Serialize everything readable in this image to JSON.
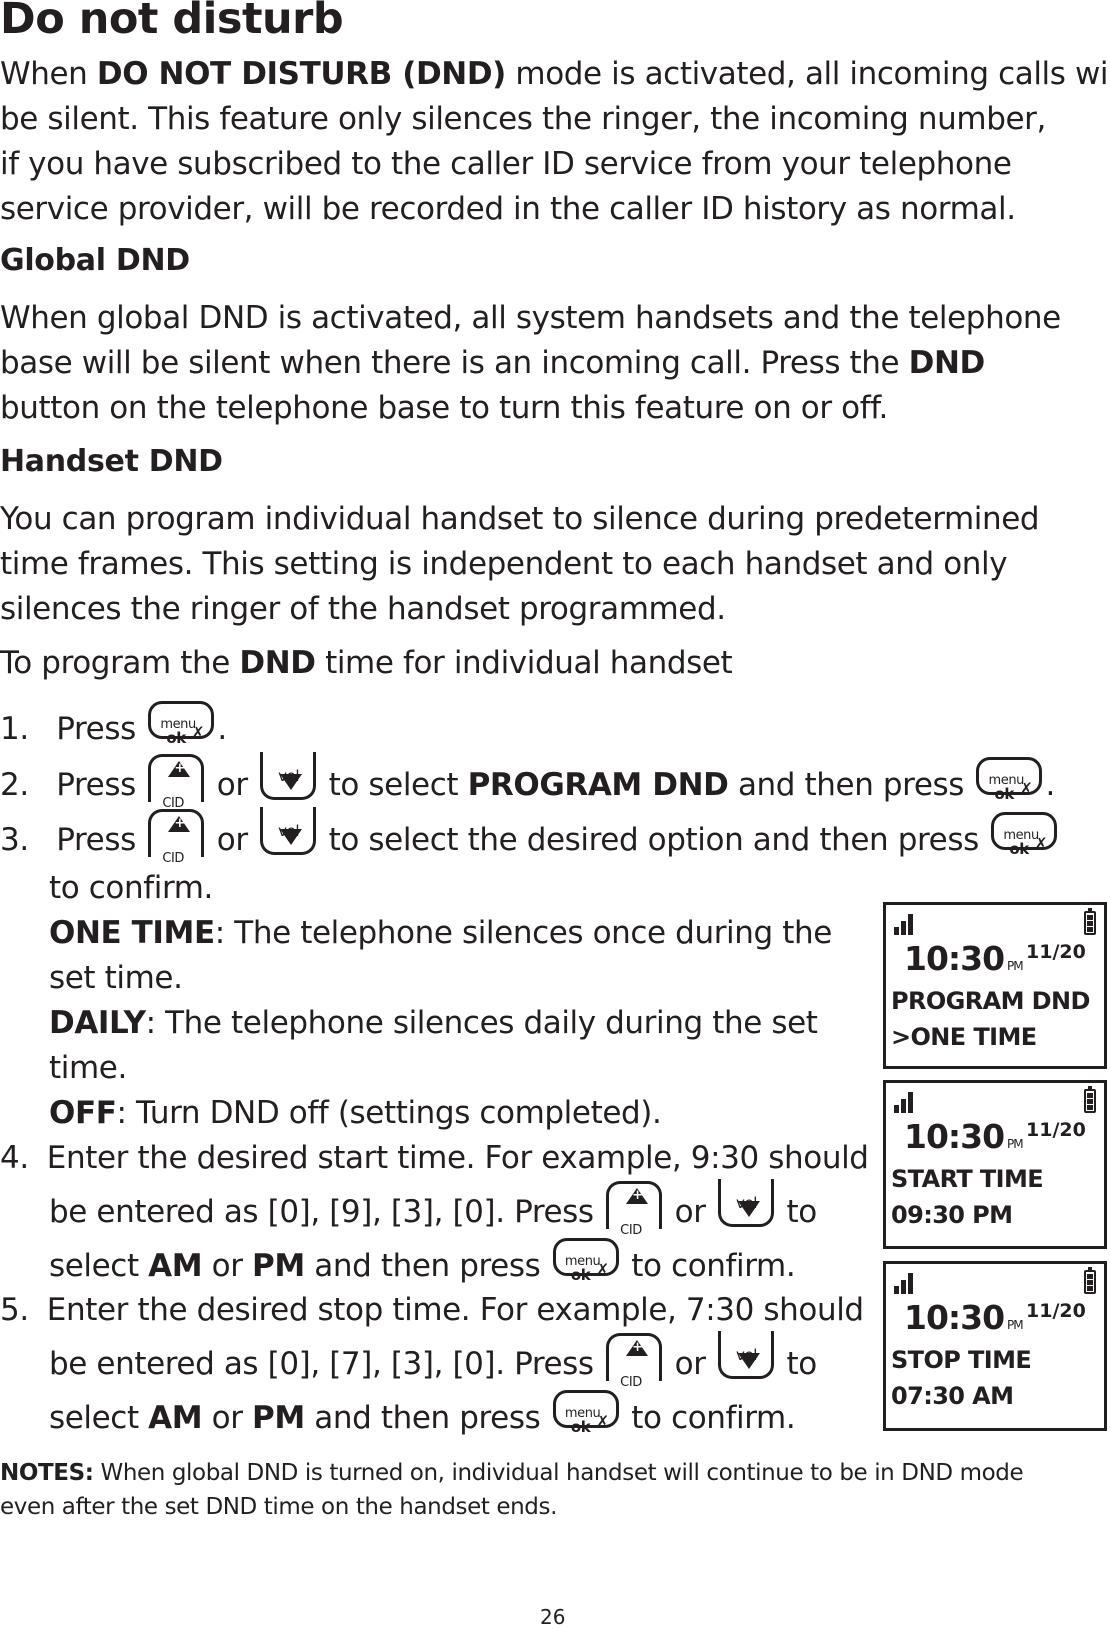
{
  "title": "Do not disturb",
  "intro": {
    "line1_pre": "When ",
    "line1_bold": "DO NOT DISTURB (DND)",
    "line1_post": " mode is activated, all incoming calls will",
    "line2": "be silent. This feature only silences the ringer, the incoming number,",
    "line3": "if you have subscribed to the caller ID service from your telephone",
    "line4": "service provider, will be recorded in the caller ID history as normal."
  },
  "global": {
    "heading": "Global DND",
    "line1": "When global DND is activated, all system handsets and the telephone",
    "line2_pre": "base will be silent when there is an incoming call. Press the ",
    "line2_bold": "DND",
    "line3": "button on the telephone base to turn this feature on or off."
  },
  "handset": {
    "heading": "Handset DND",
    "line1": "You can program individual handset to silence during predetermined",
    "line2": "time frames. This setting is independent to each handset and only",
    "line3": "silences the ringer of the handset programmed.",
    "program_pre": "To program the ",
    "program_bold": "DND",
    "program_post": " time for individual handset"
  },
  "keys": {
    "menu_top": "menu",
    "menu_bottom": "ok",
    "mute_glyph": "🎙",
    "cid": "CID",
    "vol": "vol"
  },
  "steps": [
    {
      "num": "1.",
      "press": "Press",
      "end": "."
    },
    {
      "num": "2.",
      "press": "Press",
      "or": "or",
      "mid_pre": "to select ",
      "mid_bold": "PROGRAM DND",
      "mid_post": " and then press",
      "end": "."
    },
    {
      "num": "3.",
      "press": "Press",
      "or": "or",
      "mid": "to select the desired option and then press",
      "cont": "to confirm.",
      "options": [
        {
          "name": "ONE TIME",
          "desc": ": The telephone silences once during the",
          "desc2": "set time."
        },
        {
          "name": "DAILY",
          "desc": ": The telephone silences daily during the set",
          "desc2": "time."
        },
        {
          "name": "OFF",
          "desc": ": Turn DND off (settings completed)."
        }
      ]
    },
    {
      "num": "4.",
      "line1": "Enter the desired start time. For example, 9:30 should",
      "line2_pre": "be entered as [0], [9], [3], [0]. Press",
      "or": "or",
      "to": "to",
      "select": "select ",
      "am": "AM",
      "or2": " or ",
      "pm": "PM",
      "then": " and then press",
      "confirm": "to confirm."
    },
    {
      "num": "5.",
      "line1": "Enter the desired stop time. For example, 7:30 should",
      "line2_pre": "be entered as [0], [7], [3], [0]. Press",
      "or": "or",
      "to": "to",
      "select": "select ",
      "am": "AM",
      "or2": " or ",
      "pm": "PM",
      "then": " and then press",
      "confirm": "to confirm."
    }
  ],
  "screens": [
    {
      "time": "10:30",
      "ampm": "PM",
      "date": "11/20",
      "line1": "PROGRAM DND",
      "line2": ">ONE TIME"
    },
    {
      "time": "10:30",
      "ampm": "PM",
      "date": "11/20",
      "line1": "START TIME",
      "line2": "09:30 PM"
    },
    {
      "time": "10:30",
      "ampm": "PM",
      "date": "11/20",
      "line1": "STOP TIME",
      "line2": "07:30 AM"
    }
  ],
  "notes": {
    "label": "NOTES:",
    "line1": " When global DND is turned on, individual handset will continue to be in DND mode",
    "line2": "even after the set DND time on the handset ends."
  },
  "page_number": "26"
}
